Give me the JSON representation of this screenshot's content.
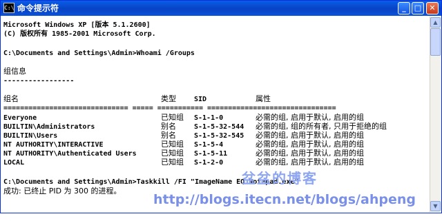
{
  "window": {
    "title": "命令提示符",
    "app_icon_text": "C:\\",
    "min_label": "_",
    "max_label": "□",
    "close_label": "✕"
  },
  "console": {
    "header": [
      "Microsoft Windows XP [版本 5.1.2600]",
      "(C) 版权所有 1985-2001 Microsoft Corp."
    ],
    "command1": "C:\\Documents and Settings\\Admin>Whoami /Groups",
    "group_info_label": "组信息",
    "underline_short": "-----------------",
    "columns": {
      "name": "组名",
      "type": "类型",
      "sid": "SID",
      "attr": "属性"
    },
    "separator": "============================== ===== =========== ===============================",
    "rows": [
      {
        "name": "Everyone",
        "type": "已知组",
        "sid": "S-1-1-0",
        "attr": "必需的组, 启用于默认, 启用的组"
      },
      {
        "name": "BUILTIN\\Administrators",
        "type": "别名",
        "sid": "S-1-5-32-544",
        "attr": "必需的组, 组的所有者, 只用于拒绝的组"
      },
      {
        "name": "BUILTIN\\Users",
        "type": "别名",
        "sid": "S-1-5-32-545",
        "attr": "必需的组, 启用于默认, 启用的组"
      },
      {
        "name": "NT AUTHORITY\\INTERACTIVE",
        "type": "已知组",
        "sid": "S-1-5-4",
        "attr": "必需的组, 启用于默认, 启用的组"
      },
      {
        "name": "NT AUTHORITY\\Authenticated Users",
        "type": "已知组",
        "sid": "S-1-5-11",
        "attr": "必需的组, 启用于默认, 启用的组"
      },
      {
        "name": "LOCAL",
        "type": "已知组",
        "sid": "S-1-2-0",
        "attr": "必需的组, 启用于默认, 启用的组"
      }
    ],
    "command2": "C:\\Documents and Settings\\Admin>Taskkill /FI \"ImageName EQ Notepad.exe\"",
    "result": "成功: 已终止 PID 为 300 的进程。"
  },
  "watermark": {
    "blog_name": "盆盆的博客",
    "url": "http://blogs.itecn.net/blogs/ahpeng"
  },
  "colors": {
    "titlebar": "#0a5de9",
    "console_bg": "#ffffff",
    "console_text": "#000000",
    "watermark": "#8fa6f0"
  }
}
